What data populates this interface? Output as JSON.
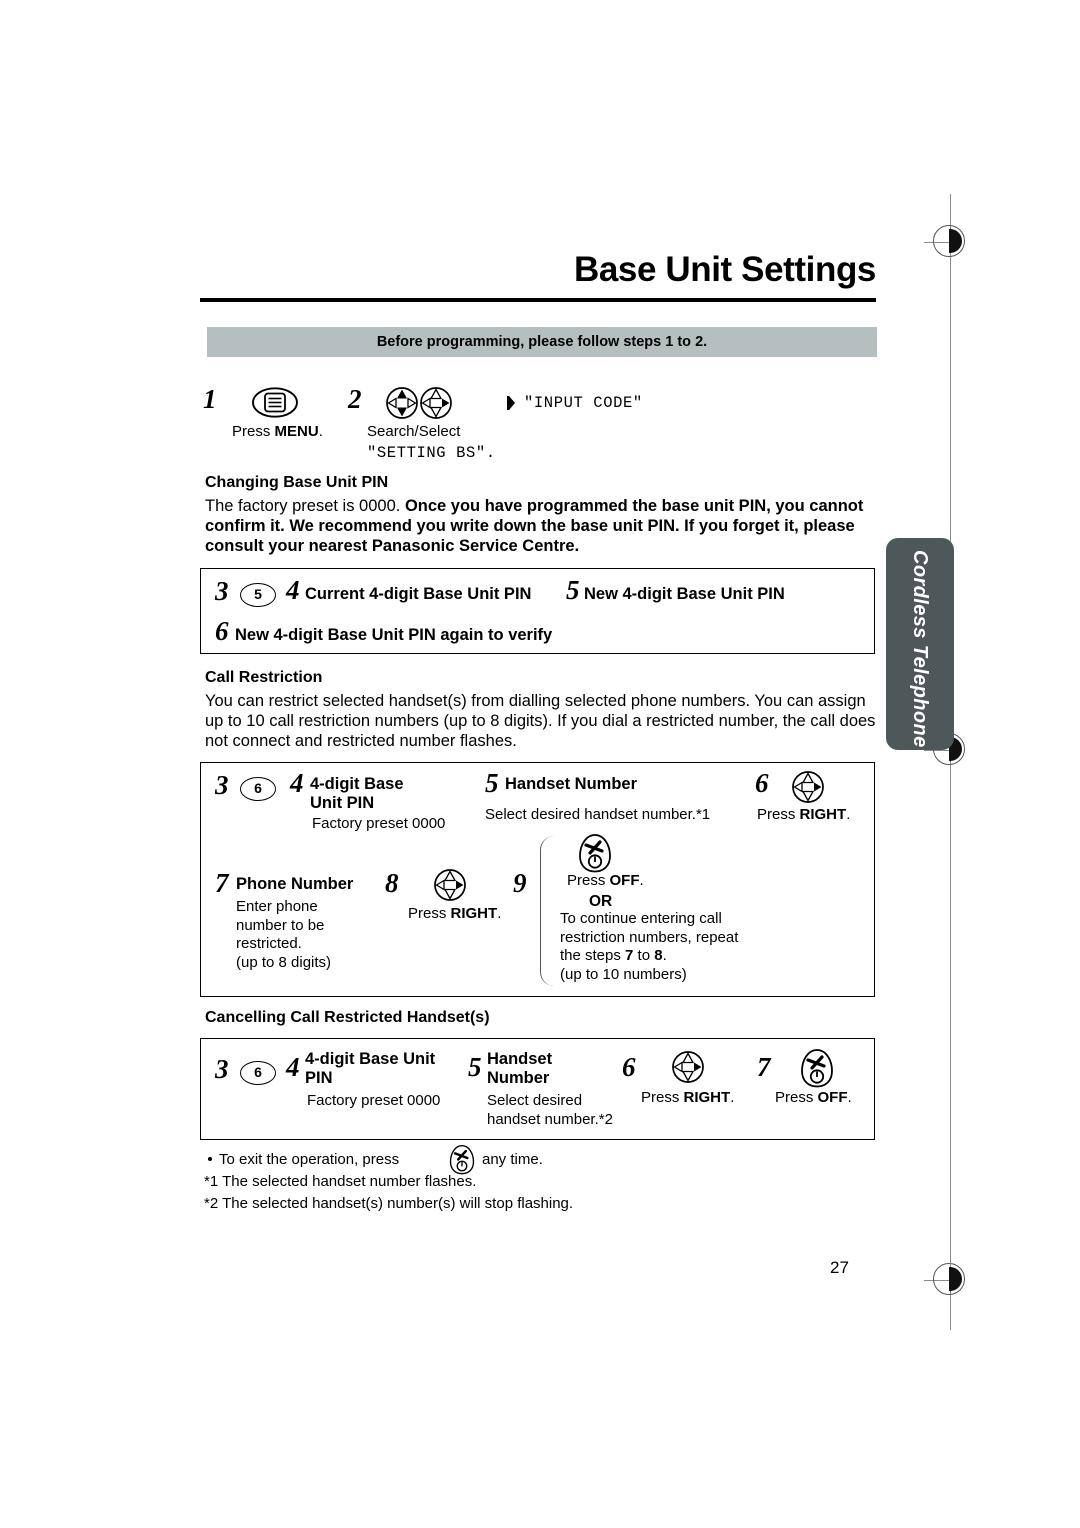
{
  "page": {
    "title": "Base Unit Settings",
    "number": "27",
    "side_tab": "Cordless Telephone",
    "banner": "Before programming, please follow steps 1 to 2."
  },
  "intro_steps": [
    {
      "num": "1",
      "icon": "menu-button-icon",
      "caption_pre": "Press ",
      "caption_bold": "MENU",
      "caption_post": "."
    },
    {
      "num": "2",
      "icon": "navigator-search-icon",
      "icon2": "navigator-select-icon",
      "caption": "Search/Select",
      "display": "\"SETTING BS\"."
    }
  ],
  "intro_display": {
    "marker": "diamond-marker-icon",
    "text": "\"INPUT CODE\""
  },
  "sections": [
    {
      "heading": "Changing Base Unit PIN",
      "paragraph_plain": "The factory preset is 0000. ",
      "paragraph_bold": "Once you have programmed the base unit PIN, you cannot confirm it. We recommend you write down the base unit PIN. If you forget it, please consult your nearest Panasonic Service Centre.",
      "steps": [
        {
          "num": "3",
          "key": "5"
        },
        {
          "num": "4",
          "label": "Current 4-digit Base Unit PIN"
        },
        {
          "num": "5",
          "label": "New 4-digit Base Unit PIN"
        },
        {
          "num": "6",
          "label": "New 4-digit Base Unit PIN again to verify"
        }
      ]
    },
    {
      "heading": "Call Restriction",
      "paragraph": "You can restrict selected handset(s) from dialling selected phone numbers. You can assign up to 10 call restriction numbers (up to 8 digits). If you dial a restricted number, the call does not connect and restricted number flashes.",
      "steps": [
        {
          "num": "3",
          "key": "6"
        },
        {
          "num": "4",
          "label": "4-digit Base Unit PIN",
          "sub": "Factory preset 0000"
        },
        {
          "num": "5",
          "label": "Handset Number",
          "sub": "Select desired handset number.*1"
        },
        {
          "num": "6",
          "icon": "navigator-right-icon",
          "caption_pre": "Press ",
          "caption_bold": "RIGHT",
          "caption_post": "."
        },
        {
          "num": "7",
          "label": "Phone Number",
          "sub": "Enter phone number to be restricted. (up to 8 digits)"
        },
        {
          "num": "8",
          "icon": "navigator-right-icon",
          "caption_pre": "Press ",
          "caption_bold": "RIGHT",
          "caption_post": "."
        },
        {
          "num": "9",
          "icon": "off-button-icon",
          "caption_pre": "Press ",
          "caption_bold": "OFF",
          "caption_post": ".",
          "or": "OR",
          "alt_text": "To continue entering call restriction numbers, repeat the steps 7 to 8.",
          "alt_note": "(up to 10 numbers)"
        }
      ]
    },
    {
      "heading": "Cancelling Call Restricted Handset(s)",
      "steps": [
        {
          "num": "3",
          "key": "6"
        },
        {
          "num": "4",
          "label": "4-digit Base Unit PIN",
          "sub": "Factory preset 0000"
        },
        {
          "num": "5",
          "label": "Handset Number",
          "sub": "Select desired handset number.*2"
        },
        {
          "num": "6",
          "icon": "navigator-right-icon",
          "caption_pre": "Press ",
          "caption_bold": "RIGHT",
          "caption_post": "."
        },
        {
          "num": "7",
          "icon": "off-button-icon",
          "caption_pre": "Press ",
          "caption_bold": "OFF",
          "caption_post": "."
        }
      ]
    }
  ],
  "notes": {
    "exit_pre": "To exit the operation, press",
    "exit_icon": "off-button-icon",
    "exit_post": "any time.",
    "note1": "*1 The selected handset number flashes.",
    "note2": "*2 The selected handset(s) number(s) will stop flashing."
  },
  "step7_alt_lines": {
    "l1": "To continue entering call",
    "l2": "restriction numbers, repeat",
    "l3_pre": "the steps ",
    "l3_a": "7",
    "l3_mid": " to ",
    "l3_b": "8",
    "l3_post": ".",
    "l4": "(up to 10 numbers)"
  },
  "step7_sub_lines": {
    "l1": "Enter phone",
    "l2": "number to be",
    "l3": "restricted.",
    "l4": "(up to 8 digits)"
  },
  "cancel_sub_lines": {
    "l1": "Select desired",
    "l2": "handset number.*2"
  },
  "colors": {
    "banner": "#b5bfbf",
    "tab": "#4e585a",
    "rule": "#000000"
  }
}
